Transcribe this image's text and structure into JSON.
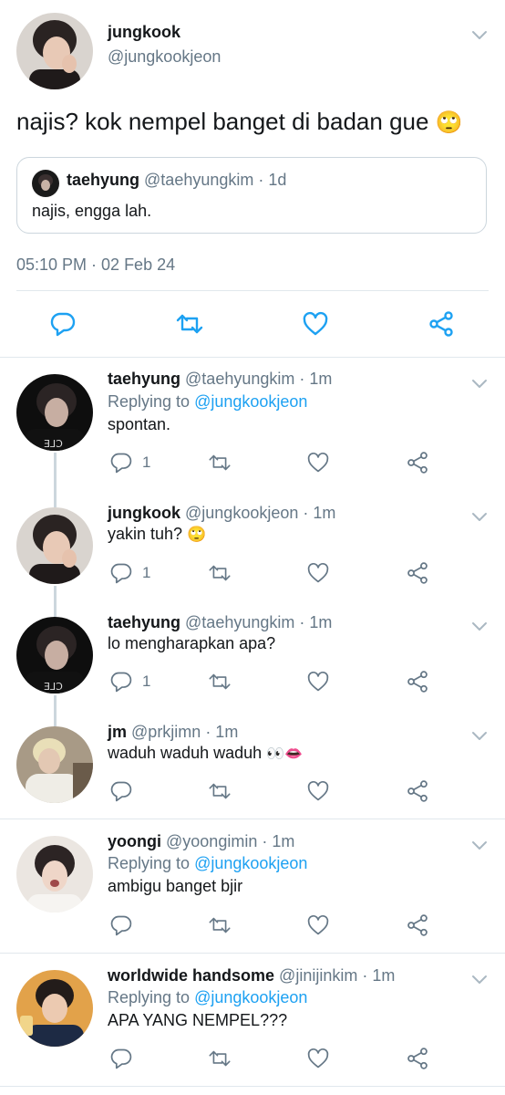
{
  "main_tweet": {
    "name": "jungkook",
    "handle": "@jungkookjeon",
    "text": "najis? kok nempel banget di badan gue",
    "emoji": "🙄",
    "quote": {
      "name": "taehyung",
      "handle_time": "@taehyungkim · 1d",
      "text": "najis, engga lah."
    },
    "timestamp": "05:10 PM · 02 Feb 24"
  },
  "replies": [
    {
      "name": "taehyung",
      "meta": "@taehyungkim · 1m",
      "replying_prefix": "Replying to ",
      "replying_to": "@jungkookjeon",
      "text": "spontan.",
      "reply_count": "1"
    },
    {
      "name": "jungkook",
      "meta": "@jungkookjeon · 1m",
      "text": "yakin tuh?",
      "emoji": "🙄",
      "reply_count": "1"
    },
    {
      "name": "taehyung",
      "meta": "@taehyungkim · 1m",
      "text": "lo mengharapkan apa?",
      "reply_count": "1"
    },
    {
      "name": "jm",
      "meta": "@prkjimn · 1m",
      "text": "waduh waduh waduh",
      "emoji": "👀👄"
    },
    {
      "name": "yoongi",
      "meta": "@yoongimin · 1m",
      "replying_prefix": "Replying to ",
      "replying_to": "@jungkookjeon",
      "text": "ambigu banget bjir"
    },
    {
      "name": "worldwide handsome",
      "meta": "@jinijinkim · 1m",
      "replying_prefix": "Replying to ",
      "replying_to": "@jungkookjeon",
      "text": "APA YANG NEMPEL???"
    }
  ],
  "colors": {
    "link": "#1da1f2",
    "secondary_text": "#657786",
    "divider": "#e1e8ed",
    "thread_line": "#ccd6dd"
  },
  "icons": [
    "chevron-down-icon",
    "reply-icon",
    "retweet-icon",
    "like-icon",
    "share-icon"
  ]
}
